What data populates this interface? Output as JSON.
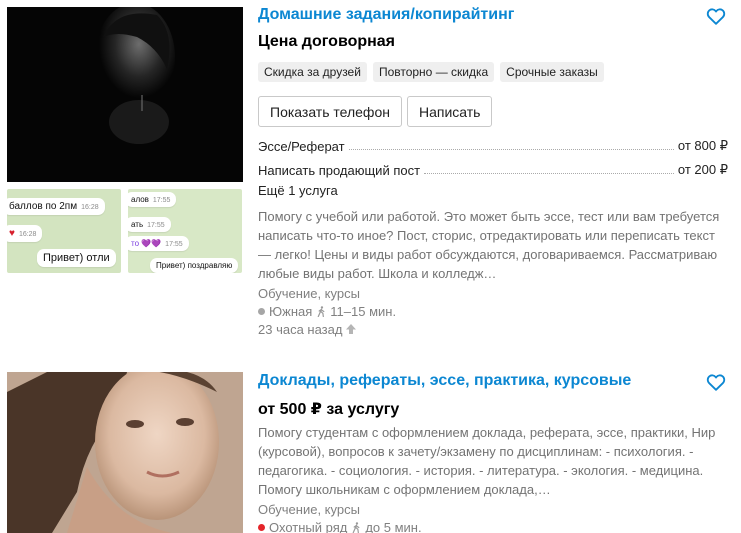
{
  "listings": [
    {
      "title": "Домашние задания/копирайтинг",
      "price": "Цена договорная",
      "tags": [
        "Скидка за друзей",
        "Повторно — скидка",
        "Срочные заказы"
      ],
      "buttons": {
        "phone": "Показать телефон",
        "message": "Написать"
      },
      "services": [
        {
          "name": "Эссе/Реферат",
          "price": "от 800 ₽"
        },
        {
          "name": "Написать продающий пост",
          "price": "от 200 ₽"
        }
      ],
      "more_services": "Ещё 1 услуга",
      "description": "Помогу с учебой или работой. Это может быть эссе, тест или вам требуется написать что-то иное? Пост, сторис, отредактировать или переписать текст — легко! Цены и виды работ обсуждаются, договариваемся. Рассматриваю любые виды работ. Школа и колледж…",
      "category": "Обучение, курсы",
      "metro": {
        "station": "Южная",
        "walk": "11–15 мин.",
        "color": "#a6a6a6"
      },
      "posted": "23 часа назад",
      "thumb_a": {
        "bubbles": [
          {
            "text": "баллов по 2пм",
            "time": "16:28"
          },
          {
            "text": "♥",
            "time": "16:28"
          },
          {
            "text": "Привет) отли",
            "time": ""
          }
        ]
      },
      "thumb_b": {
        "bubbles": [
          {
            "text": "алов",
            "time": "17:55"
          },
          {
            "text": "ать",
            "time": "17:55"
          },
          {
            "text": "то 💜💜",
            "time": "17:55"
          },
          {
            "text": "Привет) поздравляю",
            "time": ""
          }
        ]
      }
    },
    {
      "title": "Доклады, рефераты, эссе, практика, курсовые",
      "price": "от 500 ₽ за услугу",
      "description": "Помогу студентам с оформлением доклада, реферата, эссе, практики, Нир (курсовой), вопросов к зачету/экзамену по дисциплинам: - психология. - педагогика. - социология. - история. - литература. - экология. - медицина. Помогу школьникам с оформлением доклада,…",
      "category": "Обучение, курсы",
      "metro": {
        "station": "Охотный ряд",
        "walk": "до 5 мин.",
        "color": "#e4252a"
      }
    }
  ],
  "colors": {
    "accent": "#0c87d2",
    "muted": "#808080"
  },
  "icons": {
    "favorite": "heart-outline-icon",
    "walk": "pedestrian-icon",
    "raise": "arrow-up-icon"
  }
}
